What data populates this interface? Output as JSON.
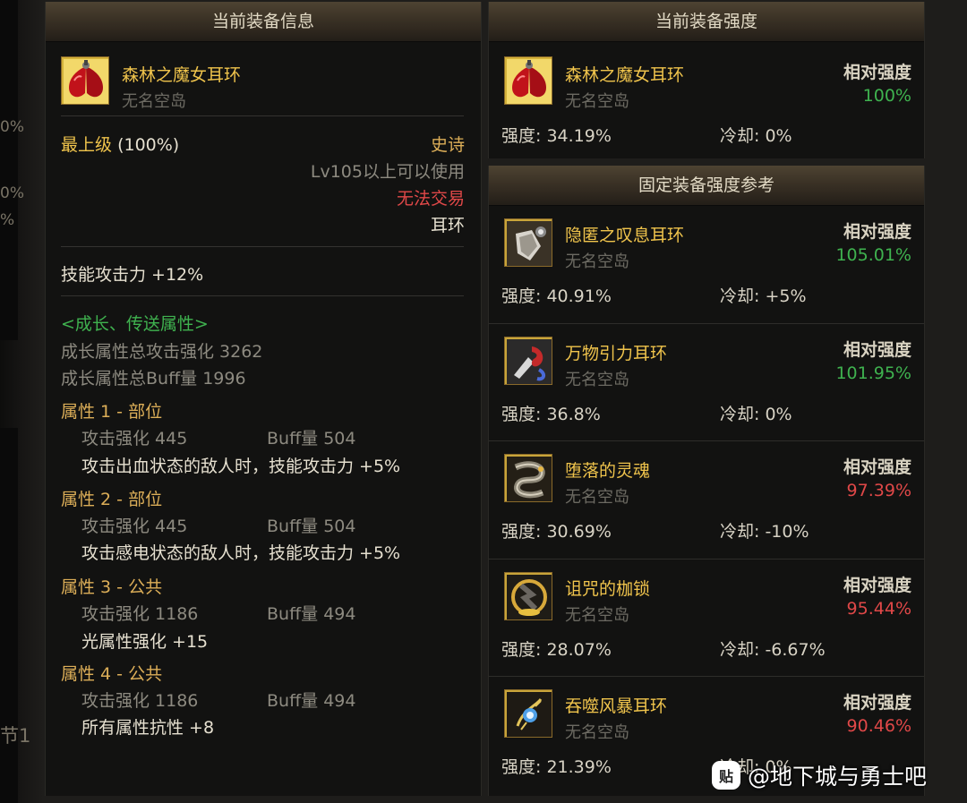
{
  "background_fragments": [
    "0%",
    "0%",
    "%",
    "节1"
  ],
  "current_info": {
    "title": "当前装备信息",
    "item_name": "森林之魔女耳环",
    "item_source": "无名空岛",
    "grade": "最上级",
    "grade_pct": "(100%)",
    "rarity": "史诗",
    "level_req": "Lv105以上可以使用",
    "trade": "无法交易",
    "slot": "耳环",
    "skill_attack": "技能攻击力 +12%",
    "growth_header": "<成长、传送属性>",
    "growth_total_attack": "成长属性总攻击强化 3262",
    "growth_total_buff": "成长属性总Buff量 1996",
    "attributes": [
      {
        "title": "属性 1 - 部位",
        "atk": "攻击强化  445",
        "buff": "Buff量  504",
        "effect": "攻击出血状态的敌人时，技能攻击力 +5%"
      },
      {
        "title": "属性 2 - 部位",
        "atk": "攻击强化  445",
        "buff": "Buff量  504",
        "effect": "攻击感电状态的敌人时，技能攻击力 +5%"
      },
      {
        "title": "属性 3 - 公共",
        "atk": "攻击强化  1186",
        "buff": "Buff量  494",
        "effect": "光属性强化 +15"
      },
      {
        "title": "属性 4 - 公共",
        "atk": "攻击强化  1186",
        "buff": "Buff量  494",
        "effect": "所有属性抗性 +8"
      }
    ]
  },
  "current_strength": {
    "title": "当前装备强度",
    "item_name": "森林之魔女耳环",
    "item_source": "无名空岛",
    "rel_label": "相对强度",
    "rel_value": "100%",
    "strength": "强度: 34.19%",
    "cooldown": "冷却: 0%"
  },
  "reference": {
    "title": "固定装备强度参考",
    "items": [
      {
        "name": "隐匿之叹息耳环",
        "source": "无名空岛",
        "rel_label": "相对强度",
        "rel_value": "105.01%",
        "status": "up",
        "strength": "强度: 40.91%",
        "cooldown": "冷却: +5%",
        "icon": "sigh-earring-icon"
      },
      {
        "name": "万物引力耳环",
        "source": "无名空岛",
        "rel_label": "相对强度",
        "rel_value": "101.95%",
        "status": "up",
        "strength": "强度: 36.8%",
        "cooldown": "冷却: 0%",
        "icon": "gravity-earring-icon"
      },
      {
        "name": "堕落的灵魂",
        "source": "无名空岛",
        "rel_label": "相对强度",
        "rel_value": "97.39%",
        "status": "down",
        "strength": "强度: 30.69%",
        "cooldown": "冷却: -10%",
        "icon": "fallen-soul-icon"
      },
      {
        "name": "诅咒的枷锁",
        "source": "无名空岛",
        "rel_label": "相对强度",
        "rel_value": "95.44%",
        "status": "down",
        "strength": "强度: 28.07%",
        "cooldown": "冷却: -6.67%",
        "icon": "cursed-shackle-icon"
      },
      {
        "name": "吞噬风暴耳环",
        "source": "无名空岛",
        "rel_label": "相对强度",
        "rel_value": "90.46%",
        "status": "down",
        "strength": "强度: 21.39%",
        "cooldown": "冷却: 0%",
        "icon": "storm-earring-icon"
      }
    ]
  },
  "watermark": {
    "logo": "贴",
    "text": "@地下城与勇士吧"
  },
  "colors": {
    "name": "#f0c44c",
    "up": "#3fb24f",
    "down": "#e04848",
    "panel": "#121211",
    "growth": "#3fb24f"
  }
}
